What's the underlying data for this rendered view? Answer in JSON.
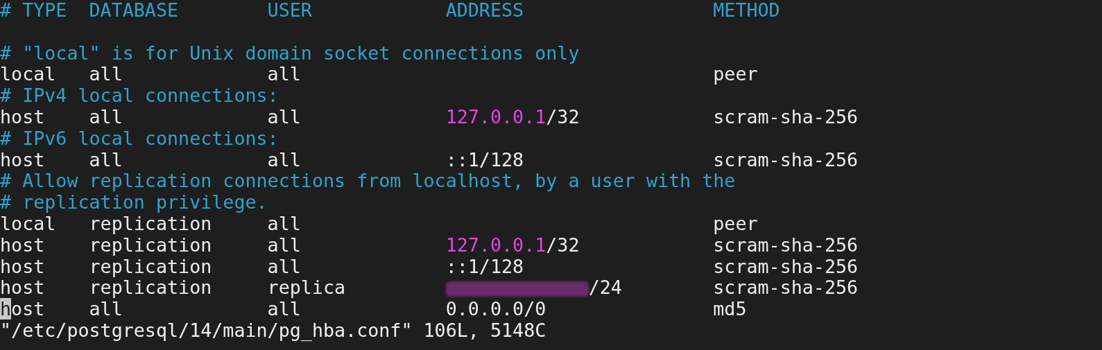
{
  "lines": [
    {
      "kind": "header",
      "cells": [
        "# TYPE",
        "DATABASE",
        "USER",
        "ADDRESS",
        "METHOD"
      ]
    },
    {
      "kind": "blank"
    },
    {
      "kind": "comment",
      "text": "# \"local\" is for Unix domain socket connections only"
    },
    {
      "kind": "entry",
      "cursor": false,
      "cells": [
        "local",
        "all",
        "all",
        null,
        "peer"
      ]
    },
    {
      "kind": "comment",
      "text": "# IPv4 local connections:"
    },
    {
      "kind": "entry",
      "cursor": false,
      "cells": [
        "host",
        "all",
        "all",
        {
          "ip": "127.0.0.1",
          "suffix": "/32"
        },
        "scram-sha-256"
      ]
    },
    {
      "kind": "comment",
      "text": "# IPv6 local connections:"
    },
    {
      "kind": "entry",
      "cursor": false,
      "cells": [
        "host",
        "all",
        "all",
        {
          "suffix": "::1/128"
        },
        "scram-sha-256"
      ]
    },
    {
      "kind": "comment",
      "text": "# Allow replication connections from localhost, by a user with the"
    },
    {
      "kind": "comment",
      "text": "# replication privilege."
    },
    {
      "kind": "entry",
      "cursor": false,
      "cells": [
        "local",
        "replication",
        "all",
        null,
        "peer"
      ]
    },
    {
      "kind": "entry",
      "cursor": false,
      "cells": [
        "host",
        "replication",
        "all",
        {
          "ip": "127.0.0.1",
          "suffix": "/32"
        },
        "scram-sha-256"
      ]
    },
    {
      "kind": "entry",
      "cursor": false,
      "cells": [
        "host",
        "replication",
        "all",
        {
          "suffix": "::1/128"
        },
        "scram-sha-256"
      ]
    },
    {
      "kind": "entry",
      "cursor": false,
      "cells": [
        "host",
        "replication",
        "replica",
        {
          "redacted": true,
          "suffix": "/24"
        },
        "scram-sha-256"
      ]
    },
    {
      "kind": "entry",
      "cursor": true,
      "cells": [
        "host",
        "all",
        "all",
        {
          "suffix": "0.0.0.0/0"
        },
        "md5"
      ]
    },
    {
      "kind": "status",
      "text": "\"/etc/postgresql/14/main/pg_hba.conf\" 106L, 5148C"
    }
  ]
}
